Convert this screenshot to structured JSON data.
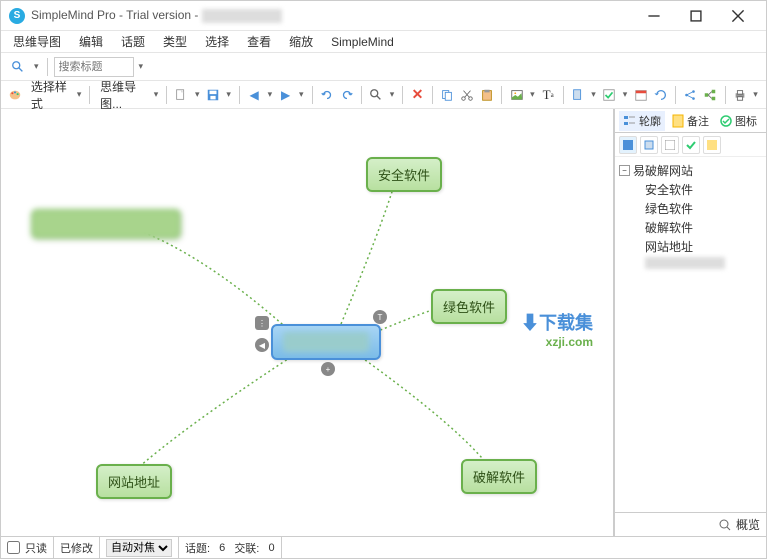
{
  "window": {
    "title": "SimpleMind Pro - Trial version -"
  },
  "menu": {
    "mindmap": "思维导图",
    "edit": "编辑",
    "topic": "话题",
    "type": "类型",
    "select": "选择",
    "view": "查看",
    "zoom": "缩放",
    "simplemind": "SimpleMind"
  },
  "toolbar1": {
    "search_placeholder": "搜索标题"
  },
  "toolbar2": {
    "select_style": "选择样式",
    "mindmap_label": "思维导图..."
  },
  "nodes": {
    "security": "安全软件",
    "green": "绿色软件",
    "crack": "破解软件",
    "website": "网站地址"
  },
  "watermark": {
    "text": "下载集",
    "url": "xzji.com"
  },
  "panel": {
    "outline": "轮廓",
    "notes": "备注",
    "icons": "图标",
    "preview": "概览"
  },
  "tree": {
    "root": "易破解网站",
    "child1": "安全软件",
    "child2": "绿色软件",
    "child3": "破解软件",
    "child4": "网站地址"
  },
  "status": {
    "readonly": "只读",
    "modified": "已修改",
    "autofocus": "自动对焦",
    "topics_label": "话题:",
    "topics_count": "6",
    "links_label": "交联:",
    "links_count": "0"
  },
  "colors": {
    "green": "#6ab04c",
    "blue": "#4a90d9"
  }
}
